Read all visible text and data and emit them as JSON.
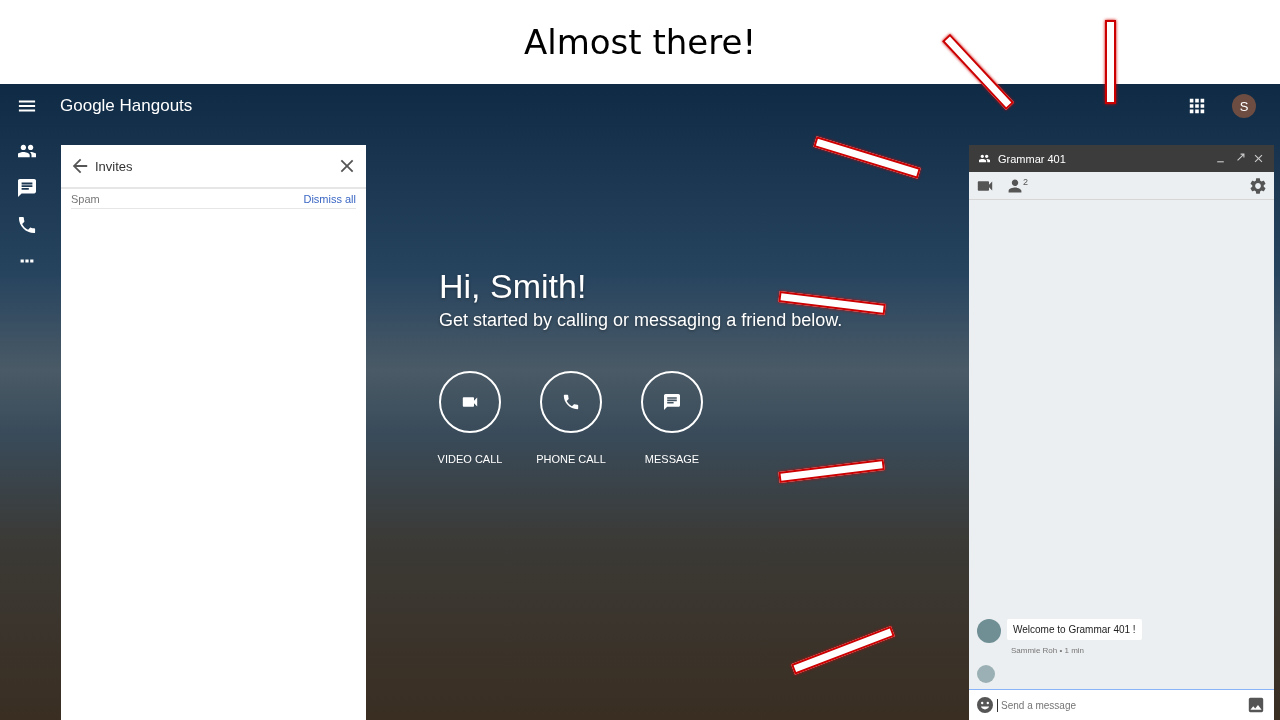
{
  "slide": {
    "title": "Almost there!"
  },
  "app": {
    "title": "Google Hangouts",
    "avatar_initial": "S"
  },
  "invites": {
    "title": "Invites",
    "section": "Spam",
    "action": "Dismiss all"
  },
  "hero": {
    "greeting": "Hi, Smith!",
    "subtitle": "Get started by calling or messaging a friend below.",
    "actions": [
      {
        "kind": "video",
        "label": "VIDEO CALL"
      },
      {
        "kind": "phone",
        "label": "PHONE CALL"
      },
      {
        "kind": "message",
        "label": "MESSAGE"
      }
    ]
  },
  "chat": {
    "title": "Grammar 401",
    "participant_count": "2",
    "messages": [
      {
        "text": "Welcome to Grammar 401 !",
        "meta": "Sammie Roh • 1 min"
      }
    ],
    "input": {
      "placeholder": "Send a message"
    }
  }
}
